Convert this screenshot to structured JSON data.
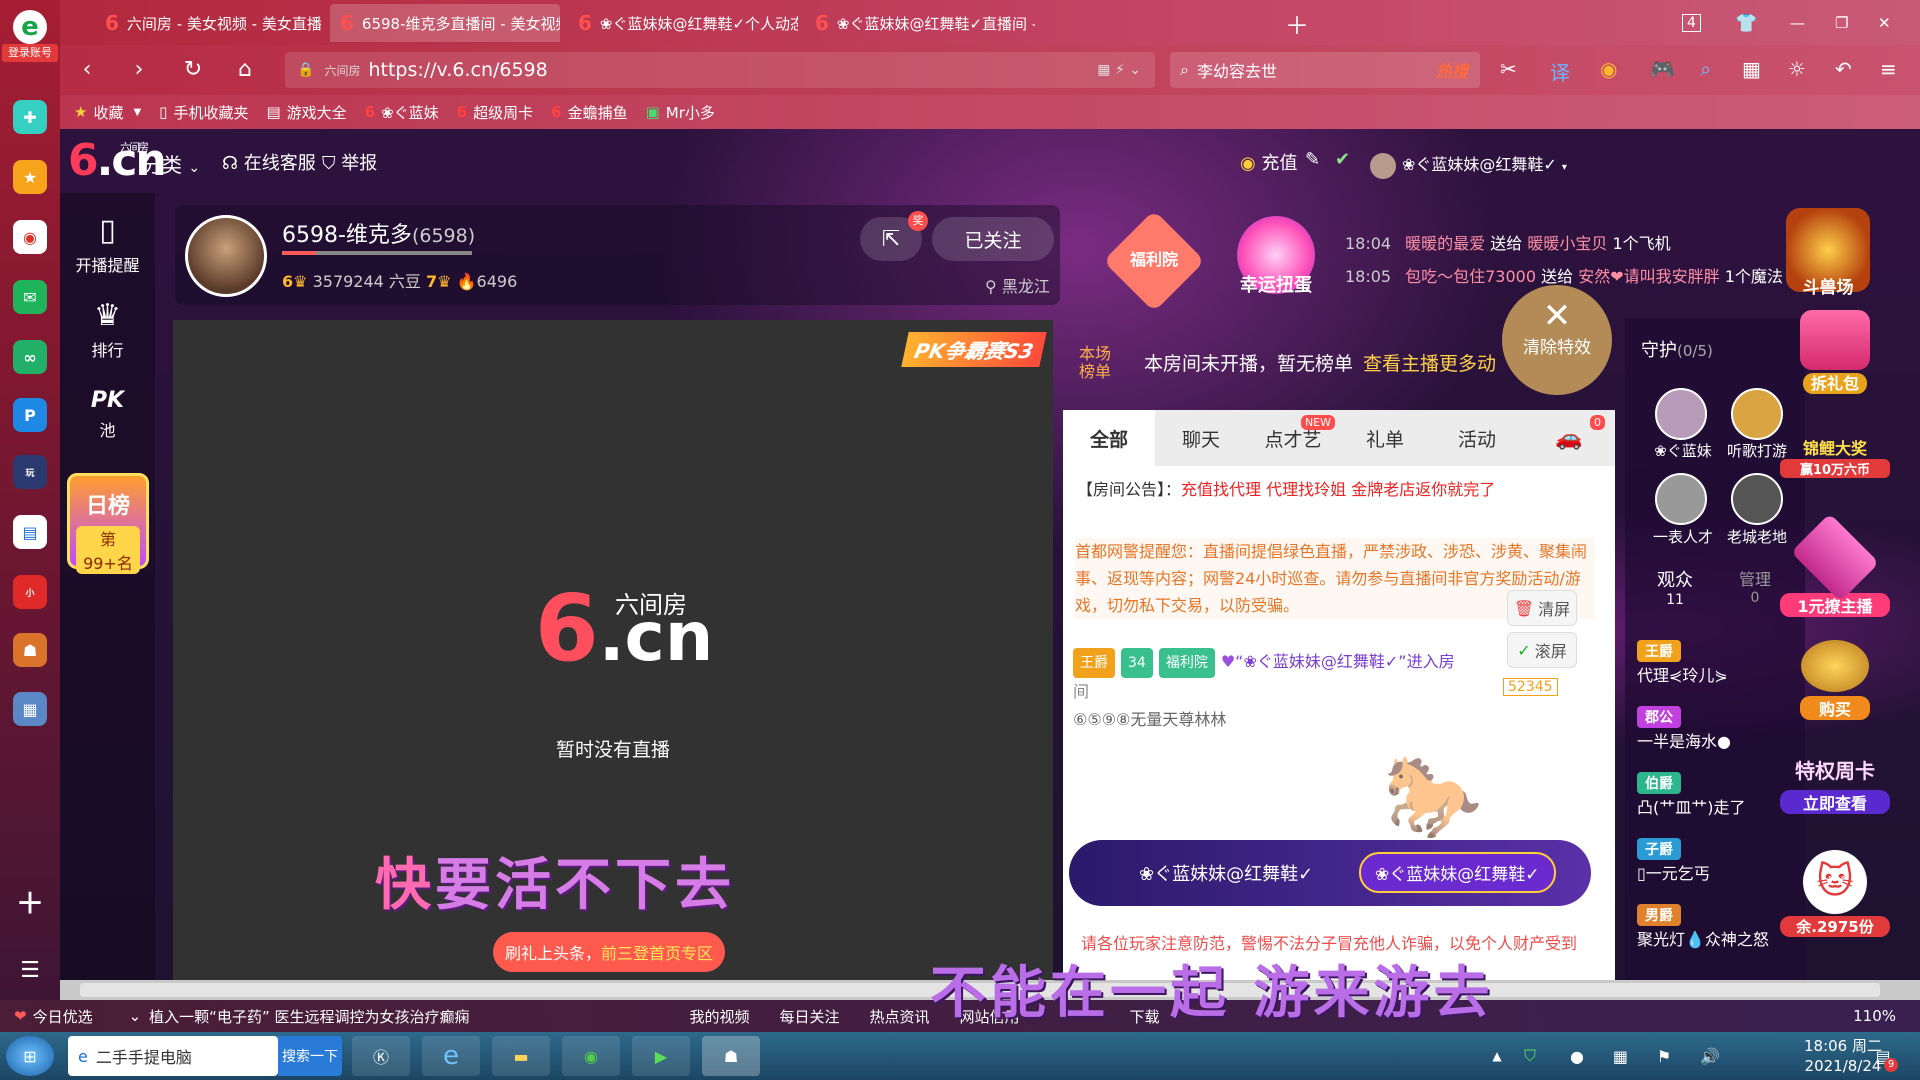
{
  "browser": {
    "tabs": [
      {
        "label": "六间房 - 美女视频 - 美女直播",
        "active": false
      },
      {
        "label": "6598-维克多直播间 - 美女视频",
        "active": true
      },
      {
        "label": "❀ぐ蓝妹妹@红舞鞋✓个人动态",
        "active": false
      },
      {
        "label": "❀ぐ蓝妹妹@红舞鞋✓直播间 -",
        "active": false
      }
    ],
    "tab_count": "4",
    "url": "https://v.6.cn/6598",
    "url_site_tag": "六间房",
    "search_text": "李幼容去世",
    "search_hot": "热搜",
    "login_label": "登录账号",
    "bookmarks": [
      "收藏",
      "手机收藏夹",
      "游戏大全",
      "❀ぐ蓝妹",
      "超级周卡",
      "金蟾捕鱼",
      "Mr小多"
    ],
    "zoom": "110%"
  },
  "site": {
    "logo_small": "六间房",
    "logo_text": ".cn",
    "category": "分类",
    "service": "在线客服",
    "report": "举报",
    "recharge": "充值",
    "username": "❀ぐ蓝妹妹@红舞鞋✓"
  },
  "left_toolbar": {
    "items": [
      {
        "icon": "phone-icon",
        "label": "开播提醒"
      },
      {
        "icon": "crown-icon",
        "label": "排行"
      },
      {
        "icon": "pk-icon",
        "label": "池"
      }
    ],
    "pk_text": "PK",
    "day_rank_title": "日榜",
    "day_rank_value": "第99+名"
  },
  "anchor": {
    "name": "6598-维克多",
    "id": "(6598)",
    "level_a": "6",
    "beans": "3579244 六豆",
    "level_b": "7",
    "fans": "6496",
    "location": "黑龙江",
    "follow_label": "已关注",
    "share_badge": "奖"
  },
  "video": {
    "logo_sub": "六间房",
    "logo_text": ".cn",
    "status": "暂时没有直播",
    "pk_badge": "PK争霸赛S3",
    "top_button_prefix": "刷礼上头条，",
    "top_button_highlight": "前三登首页专区"
  },
  "lyrics": {
    "line1_first": "快",
    "line1_rest": "要活不下去",
    "line2": "不能在一起 游来游去"
  },
  "gifts": {
    "welfare_label": "福利院",
    "lucky_label": "幸运扭蛋",
    "messages": [
      {
        "time": "18:04",
        "from": "暖暖的最爱",
        "verb": "送给",
        "to": "暖暖小宝贝",
        "gift": "1个飞机"
      },
      {
        "time": "18:05",
        "from": "包吃～包住73000",
        "verb": "送给",
        "to": "安然❤请叫我安胖胖",
        "gift": "1个魔法"
      }
    ],
    "beast_label": "斗兽场",
    "clear_fx": "清除特效"
  },
  "rank_strip": {
    "tag": "本场\n榜单",
    "text": "本房间未开播，暂无榜单",
    "link": "查看主播更多动"
  },
  "chat": {
    "tabs": [
      {
        "label": "全部",
        "active": true
      },
      {
        "label": "聊天",
        "active": false
      },
      {
        "label": "点才艺",
        "active": false,
        "new": "NEW"
      },
      {
        "label": "礼单",
        "active": false
      },
      {
        "label": "活动",
        "active": false
      }
    ],
    "car_badge": "0",
    "notice_label": "【房间公告】：",
    "notice_text": "充值找代理 代理找玲姐 金牌老店返你就完了",
    "warning": "首都网警提醒您：直播间提倡绿色直播，严禁涉政、涉恐、涉黄、聚集闹事、返现等内容；网警24小时巡查。请勿参与直播间非官方奖励活动/游戏，切勿私下交易，以防受骗。",
    "clear_btn": "清屏",
    "scroll_btn": "滚屏",
    "enter_rank": "王爵",
    "enter_level": "34",
    "enter_welfare": "福利院",
    "enter_user": "“❀ぐ蓝妹妹@红舞鞋✓”进入房",
    "enter_tail": "间",
    "enter_line2": "⑥⑤⑨⑧无量天尊林林",
    "car_number": "52345",
    "banner_user": "❀ぐ蓝妹妹@红舞鞋✓",
    "banner_user2": "❀ぐ蓝妹妹@红舞鞋✓",
    "banner_num": "52345",
    "fraud": "请各位玩家注意防范，警惕不法分子冒充他人诈骗，以免个人财产受到"
  },
  "guard": {
    "title": "守护",
    "count": "(0/5)",
    "guards": [
      "❀ぐ蓝妹",
      "听歌打游",
      "一表人才",
      "老城老地"
    ],
    "audience_label": "观众",
    "audience_count": "11",
    "admin_label": "管理",
    "admin_count": "0",
    "audience": [
      {
        "rank": "王爵",
        "name": "代理⋞玲儿⋟"
      },
      {
        "rank": "郡公",
        "name": "一半是海水●"
      },
      {
        "rank": "伯爵",
        "name": "凸(艹皿艹)走了"
      },
      {
        "rank": "子爵",
        "name": "▯一元乞丐"
      },
      {
        "rank": "男爵",
        "name": "聚光灯💧众神之怒"
      }
    ]
  },
  "promos": [
    "拆礼包",
    "锦鲤大奖",
    "赢10万六币",
    "1元撩主播",
    "购买",
    "特权周卡",
    "立即查看",
    "余.2975份"
  ],
  "statusbar": {
    "left": "今日优选",
    "news": "植入一颗“电子药” 医生远程调控为女孩治疗癫痫",
    "items": [
      "我的视频",
      "每日关注",
      "热点资讯",
      "网站信用",
      "下载"
    ],
    "zoom": "110%"
  },
  "taskbar": {
    "search_placeholder": "二手手提电脑",
    "search_btn": "搜索一下",
    "time": "18:06 周二",
    "date": "2021/8/24",
    "notify": "9"
  },
  "colors": {
    "accent": "#ff3b5c",
    "gold": "#ffb32e",
    "chrome": "#b52c44"
  }
}
